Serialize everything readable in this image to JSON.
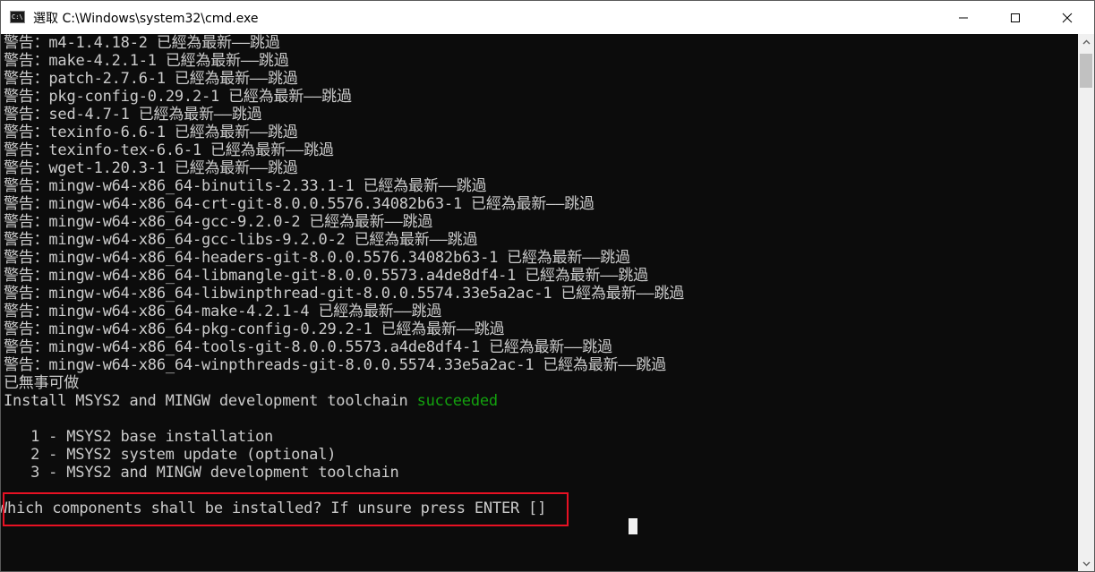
{
  "window": {
    "title": "選取 C:\\Windows\\system32\\cmd.exe",
    "icon_label": "C:\\",
    "icons": [
      "cmd-app-icon",
      "minimize-icon",
      "maximize-icon",
      "close-icon"
    ]
  },
  "console": {
    "lines": [
      "警告：m4-1.4.18-2 已經為最新——跳過",
      "警告：make-4.2.1-1 已經為最新——跳過",
      "警告：patch-2.7.6-1 已經為最新——跳過",
      "警告：pkg-config-0.29.2-1 已經為最新——跳過",
      "警告：sed-4.7-1 已經為最新——跳過",
      "警告：texinfo-6.6-1 已經為最新——跳過",
      "警告：texinfo-tex-6.6-1 已經為最新——跳過",
      "警告：wget-1.20.3-1 已經為最新——跳過",
      "警告：mingw-w64-x86_64-binutils-2.33.1-1 已經為最新——跳過",
      "警告：mingw-w64-x86_64-crt-git-8.0.0.5576.34082b63-1 已經為最新——跳過",
      "警告：mingw-w64-x86_64-gcc-9.2.0-2 已經為最新——跳過",
      "警告：mingw-w64-x86_64-gcc-libs-9.2.0-2 已經為最新——跳過",
      "警告：mingw-w64-x86_64-headers-git-8.0.0.5576.34082b63-1 已經為最新——跳過",
      "警告：mingw-w64-x86_64-libmangle-git-8.0.0.5573.a4de8df4-1 已經為最新——跳過",
      "警告：mingw-w64-x86_64-libwinpthread-git-8.0.0.5574.33e5a2ac-1 已經為最新——跳過",
      "警告：mingw-w64-x86_64-make-4.2.1-4 已經為最新——跳過",
      "警告：mingw-w64-x86_64-pkg-config-0.29.2-1 已經為最新——跳過",
      "警告：mingw-w64-x86_64-tools-git-8.0.0.5573.a4de8df4-1 已經為最新——跳過",
      "警告：mingw-w64-x86_64-winpthreads-git-8.0.0.5574.33e5a2ac-1 已經為最新——跳過",
      "已無事可做"
    ],
    "install_prefix": "Install MSYS2 and MINGW development toolchain ",
    "install_status": "succeeded",
    "options": [
      "   1 - MSYS2 base installation",
      "   2 - MSYS2 system update (optional)",
      "   3 - MSYS2 and MINGW development toolchain"
    ],
    "prompt": "Which components shall be installed? If unsure press ENTER []"
  },
  "colors": {
    "background": "#0c0c0c",
    "text": "#cccccc",
    "success": "#13a10e",
    "highlight_border": "#e81123"
  }
}
